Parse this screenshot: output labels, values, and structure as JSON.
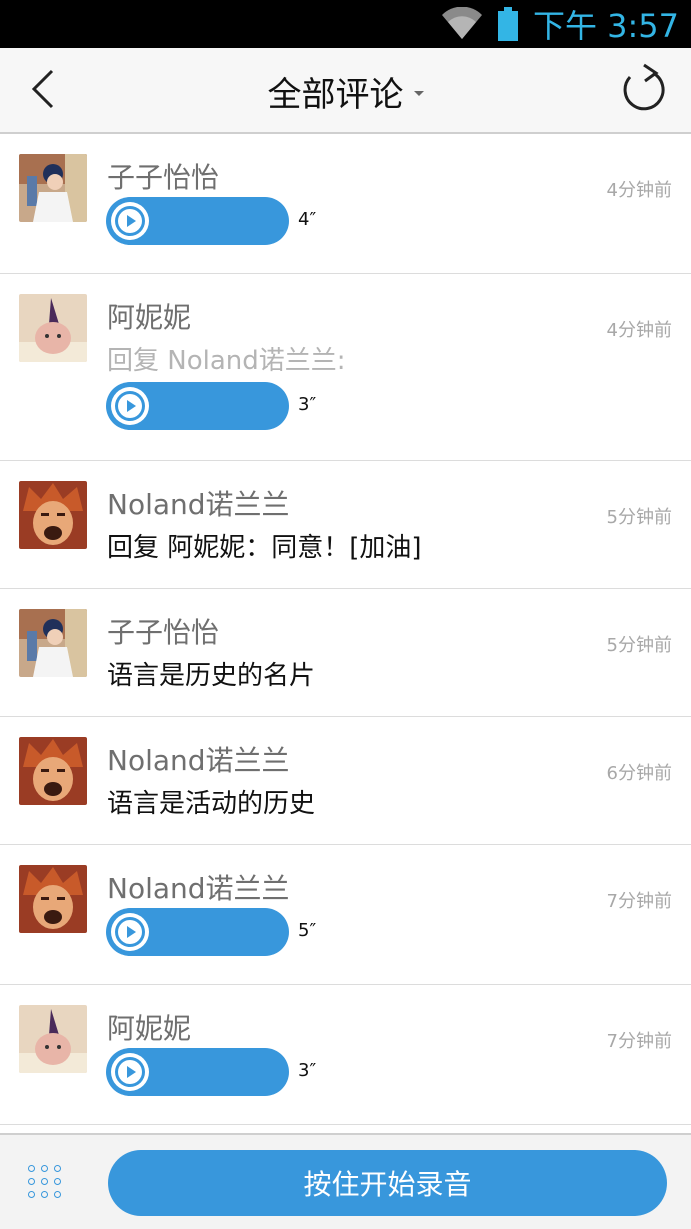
{
  "status_bar": {
    "time": "下午 3:57",
    "icons": [
      "wifi-icon",
      "battery-icon"
    ],
    "accent": "#33b5e5"
  },
  "header": {
    "title": "全部评论",
    "back_icon": "back-chevron-icon",
    "refresh_icon": "refresh-icon"
  },
  "comments": [
    {
      "name": "子子怡怡",
      "avatar": "avatar-ziziyiyi",
      "time": "4分钟前",
      "type": "voice",
      "duration": "4″"
    },
    {
      "name": "阿妮妮",
      "avatar": "avatar-anini",
      "time": "4分钟前",
      "type": "voice",
      "reply_to": "回复 Noland诺兰兰:",
      "duration": "3″"
    },
    {
      "name": "Noland诺兰兰",
      "avatar": "avatar-noland",
      "time": "5分钟前",
      "type": "text",
      "text": "回复 阿妮妮：同意！[加油]"
    },
    {
      "name": "子子怡怡",
      "avatar": "avatar-ziziyiyi",
      "time": "5分钟前",
      "type": "text",
      "text": "语言是历史的名片"
    },
    {
      "name": "Noland诺兰兰",
      "avatar": "avatar-noland",
      "time": "6分钟前",
      "type": "text",
      "text": "语言是活动的历史"
    },
    {
      "name": "Noland诺兰兰",
      "avatar": "avatar-noland",
      "time": "7分钟前",
      "type": "voice",
      "duration": "5″"
    },
    {
      "name": "阿妮妮",
      "avatar": "avatar-anini",
      "time": "7分钟前",
      "type": "voice",
      "duration": "3″"
    }
  ],
  "bottom_bar": {
    "record_label": "按住开始录音",
    "menu_icon": "grid-dots-icon"
  },
  "colors": {
    "primary": "#3897dc",
    "name_gray": "#6f6f6f",
    "time_gray": "#a8a8a8"
  }
}
